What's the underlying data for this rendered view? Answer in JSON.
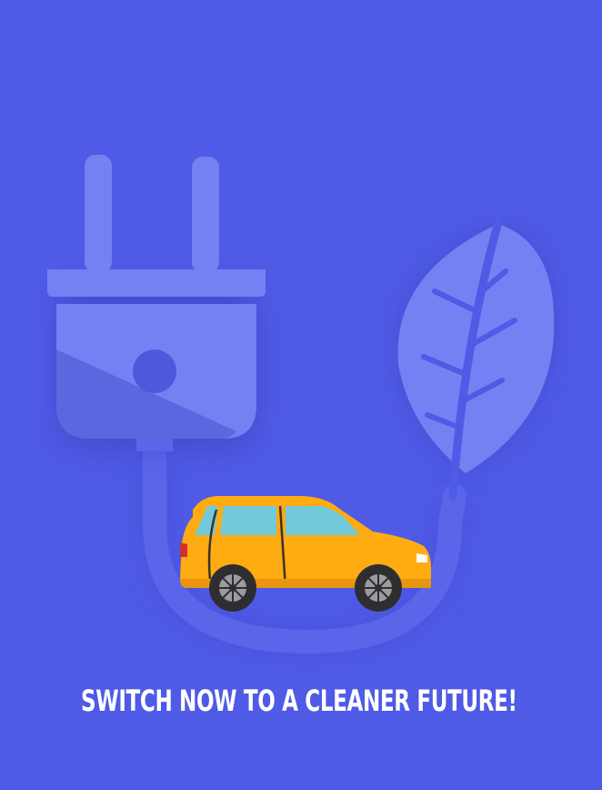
{
  "poster": {
    "headline": "SWITCH NOW TO A CLEANER FUTURE!"
  },
  "colors": {
    "background": "#4f5ae6",
    "plug_light": "#7580f2",
    "plug_dark": "#5c66df",
    "cable": "#5661e3",
    "car_body": "#ffab12",
    "car_window": "#72c9da",
    "tire": "#2e2e30",
    "text": "#ffffff"
  },
  "icons": [
    "plug-icon",
    "leaf-icon",
    "car-icon"
  ]
}
